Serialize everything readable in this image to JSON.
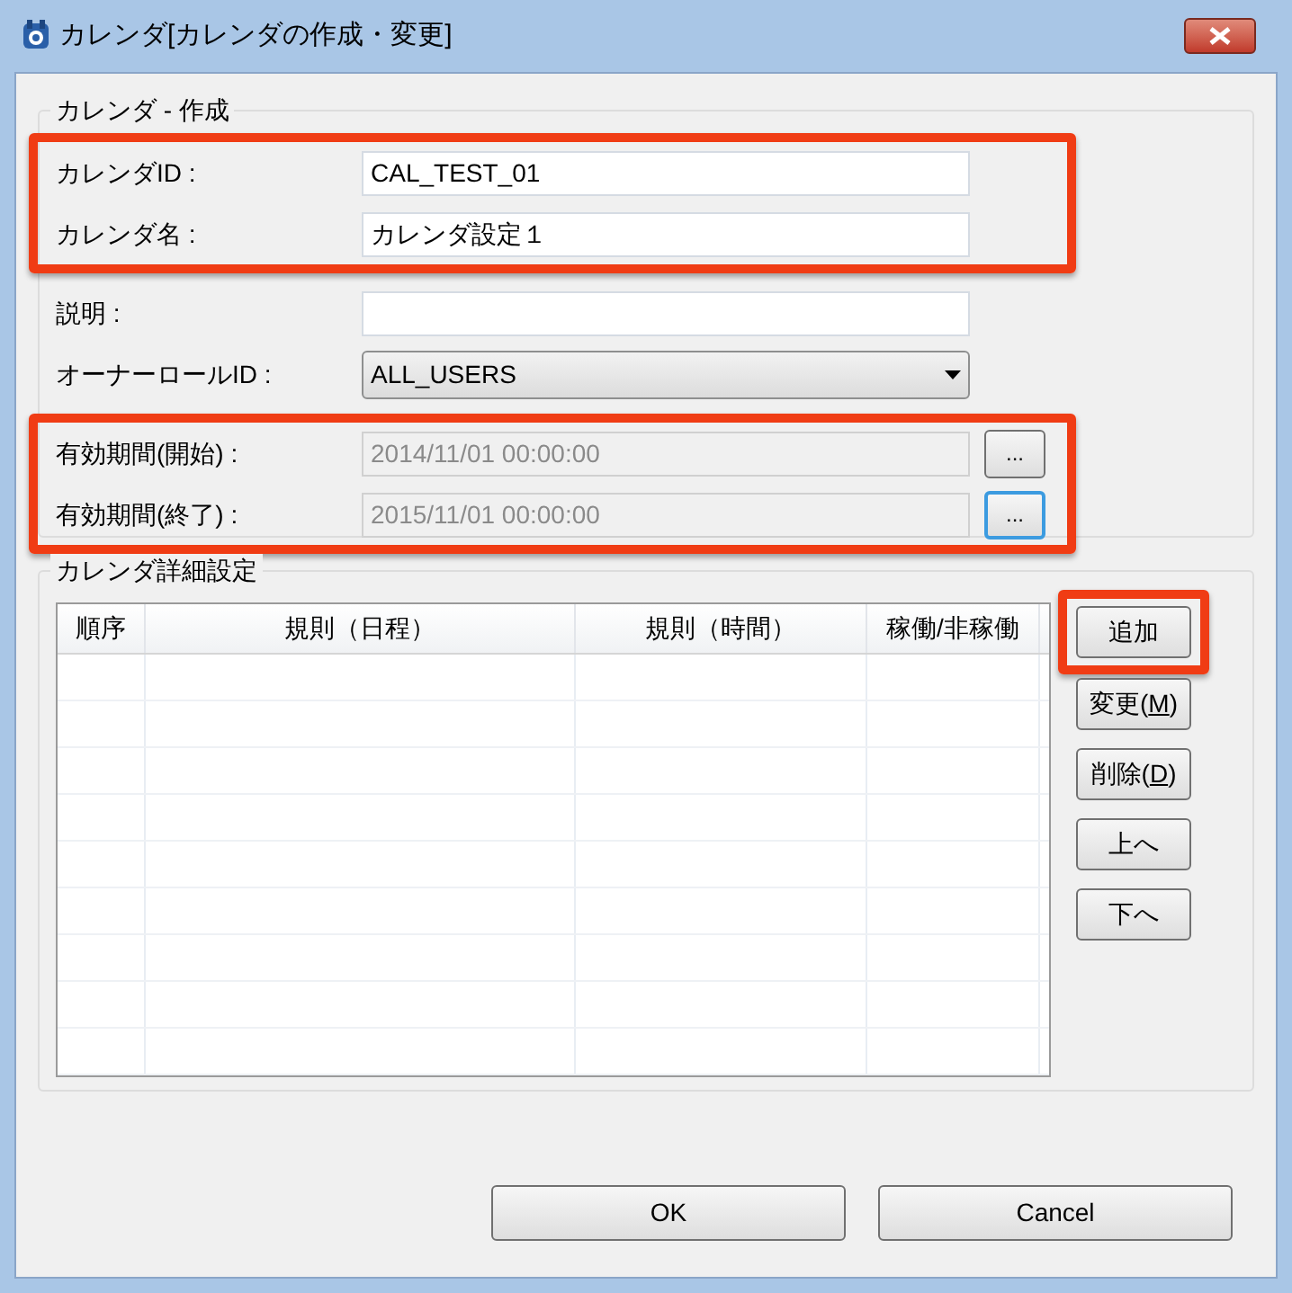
{
  "window": {
    "title": "カレンダ[カレンダの作成・変更]"
  },
  "create_group": {
    "title": "カレンダ - 作成",
    "sections": [
      {
        "highlighted": true,
        "fields": [
          {
            "kind": "text",
            "label": "カレンダID :",
            "value": "CAL_TEST_01"
          },
          {
            "kind": "text",
            "label": "カレンダ名 :",
            "value": "カレンダ設定１"
          }
        ]
      },
      {
        "highlighted": false,
        "fields": [
          {
            "kind": "text",
            "label": "説明 :"
          },
          {
            "kind": "select",
            "label": "オーナーロールID :",
            "value": "ALL_USERS"
          }
        ]
      },
      {
        "highlighted": true,
        "fields": [
          {
            "kind": "date",
            "label": "有効期間(開始) :",
            "value": "2014/11/01 00:00:00",
            "disabled": true,
            "button": "...",
            "focused": false
          },
          {
            "kind": "date",
            "label": "有効期間(終了) :",
            "value": "2015/11/01 00:00:00",
            "disabled": true,
            "button": "...",
            "focused": true
          }
        ]
      }
    ]
  },
  "detail_group": {
    "title": "カレンダ詳細設定",
    "table": {
      "columns": [
        "順序",
        "規則（日程）",
        "規則（時間）",
        "稼働/非稼働"
      ]
    },
    "buttons": [
      {
        "label": "追加",
        "highlighted": true
      },
      {
        "label": "変更(**M**)",
        "highlighted": false
      },
      {
        "label": "削除(**D**)",
        "highlighted": false
      },
      {
        "label": "上へ",
        "highlighted": false
      },
      {
        "label": "下へ",
        "highlighted": false
      }
    ]
  },
  "footer_buttons": [
    "OK",
    "Cancel"
  ]
}
